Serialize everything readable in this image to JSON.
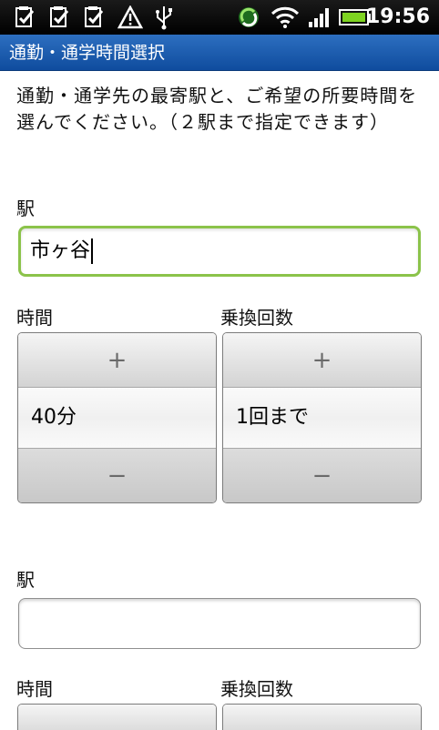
{
  "status_bar": {
    "time": "19:56",
    "icons": [
      "notification-check-icon",
      "notification-check-icon",
      "notification-check-icon",
      "warning-icon",
      "usb-icon",
      "sync-icon",
      "wifi-icon",
      "signal-icon",
      "battery-icon"
    ]
  },
  "title": "通勤・通学時間選択",
  "intro": "通勤・通学先の最寄駅と、ご希望の所要時間を選んでください。（２駅まで指定できます）",
  "station1": {
    "label": "駅",
    "value": "市ヶ谷",
    "time_label": "時間",
    "time_value": "40分",
    "transfer_label": "乗換回数",
    "transfer_value": "1回まで"
  },
  "station2": {
    "label": "駅",
    "value": "",
    "time_label": "時間",
    "transfer_label": "乗換回数"
  },
  "picker": {
    "plus": "+",
    "minus": "−"
  },
  "colors": {
    "title_bar": "#1f5fb2",
    "focus_border": "#8bc34a",
    "battery": "#7ed321"
  }
}
